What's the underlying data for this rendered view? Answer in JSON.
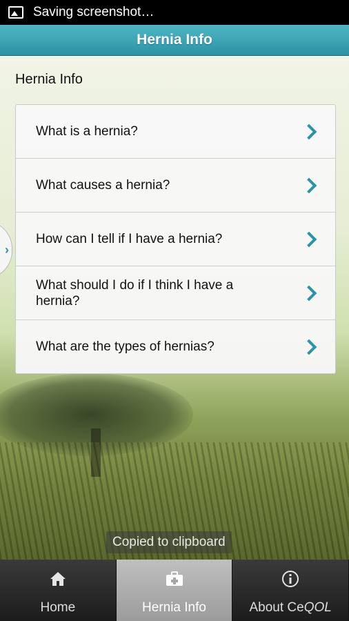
{
  "status_bar": {
    "text": "Saving screenshot…",
    "icon": "image-icon"
  },
  "header": {
    "title": "Hernia Info"
  },
  "page": {
    "title": "Hernia Info"
  },
  "list": [
    {
      "label": "What is a hernia?"
    },
    {
      "label": "What causes a hernia?"
    },
    {
      "label": "How can I tell if I have a hernia?"
    },
    {
      "label": "What should I do if I think I have a hernia?"
    },
    {
      "label": "What are the types of hernias?"
    }
  ],
  "toast": {
    "text": "Copied to clipboard"
  },
  "tabs": [
    {
      "label": "Home",
      "icon": "home-icon"
    },
    {
      "label": "Hernia Info",
      "icon": "first-aid-kit-icon",
      "active": true
    },
    {
      "label_prefix": "About Ce",
      "label_suffix": "QOL",
      "icon": "info-icon"
    }
  ],
  "colors": {
    "accent": "#2c93a5",
    "header_top": "#4fb6c4",
    "active_tab": "#b0b0b0"
  }
}
